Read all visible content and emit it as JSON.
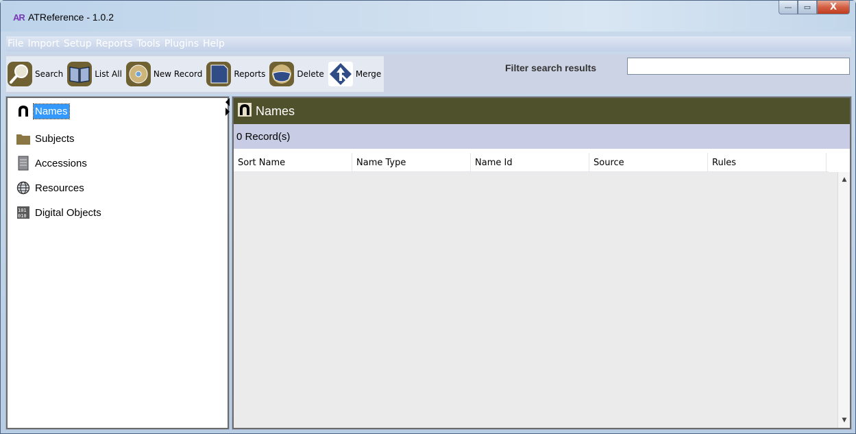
{
  "window": {
    "logo": "AR",
    "title": "ATReference - 1.0.2",
    "controls": {
      "minimize": "—",
      "maximize": "▭",
      "close": "X"
    }
  },
  "menu": [
    "File",
    "Import",
    "Setup",
    "Reports",
    "Tools",
    "Plugins",
    "Help"
  ],
  "toolbar": {
    "buttons": [
      {
        "label": "Search",
        "icon": "magnifier-icon"
      },
      {
        "label": "List All",
        "icon": "book-icon"
      },
      {
        "label": "New Record",
        "icon": "disc-icon"
      },
      {
        "label": "Reports",
        "icon": "report-icon"
      },
      {
        "label": "Delete",
        "icon": "delete-icon"
      },
      {
        "label": "Merge",
        "icon": "merge-icon"
      }
    ],
    "filter_label": "Filter search results",
    "filter_value": ""
  },
  "nav": {
    "items": [
      {
        "label": "Names",
        "icon": "name-icon",
        "selected": true
      },
      {
        "label": "Subjects",
        "icon": "folder-icon"
      },
      {
        "label": "Accessions",
        "icon": "ledger-icon"
      },
      {
        "label": "Resources",
        "icon": "globe-icon"
      },
      {
        "label": "Digital Objects",
        "icon": "binary-icon"
      }
    ]
  },
  "panel": {
    "title": "Names",
    "record_count": "0 Record(s)",
    "columns": [
      "Sort Name",
      "Name Type",
      "Name Id",
      "Source",
      "Rules"
    ]
  },
  "colors": {
    "header_bg": "#4f512c",
    "count_bg": "#c8cde5",
    "selection": "#3399ff",
    "toolbar_icon": "#6f6132"
  }
}
